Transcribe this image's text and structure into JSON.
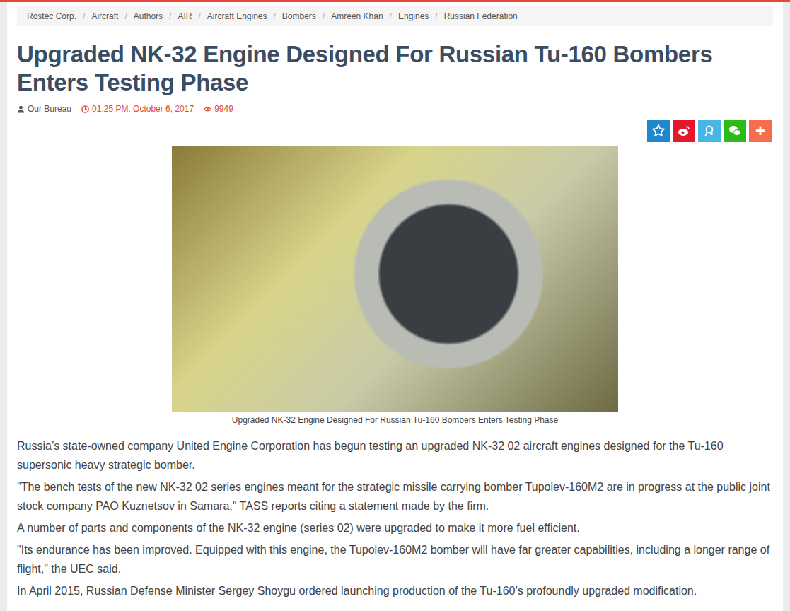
{
  "breadcrumbs": [
    "Rostec Corp.",
    "Aircraft",
    "Authors",
    "AIR",
    "Aircraft Engines",
    "Bombers",
    "Amreen Khan",
    "Engines",
    "Russian Federation"
  ],
  "breadcrumb_separator": "/",
  "title": "Upgraded NK-32 Engine Designed For Russian Tu-160 Bombers Enters Testing Phase",
  "meta": {
    "author": "Our Bureau",
    "time": "01:25 PM, October 6, 2017",
    "views": "9949"
  },
  "share_buttons": [
    {
      "kind": "qzone",
      "color": "#1f86d0"
    },
    {
      "kind": "weibo",
      "color": "#e6162d"
    },
    {
      "kind": "tqq",
      "color": "#45b6e5"
    },
    {
      "kind": "wechat",
      "color": "#2dbb1a"
    },
    {
      "kind": "more",
      "color": "#f56d4c",
      "label": "+"
    }
  ],
  "image": {
    "caption": "Upgraded NK-32 Engine Designed For Russian Tu-160 Bombers Enters Testing Phase"
  },
  "paragraphs": [
    "Russia’s state-owned company United Engine Corporation has begun testing an upgraded NK-32 02 aircraft engines designed for the Tu-160 supersonic heavy strategic bomber.",
    "\"The bench tests of the new NK-32 02 series engines meant for the strategic missile carrying bomber Tupolev-160M2 are in progress at the public joint stock company PAO Kuznetsov in Samara,\" TASS reports citing a statement made by the firm.",
    "A number of parts and components of the NK-32 engine (series 02) were upgraded to make it more fuel efficient.",
    "\"Its endurance has been improved. Equipped with this engine, the Tupolev-160M2 bomber will have far greater capabilities, including a longer range of flight,\" the UEC said.",
    "In April 2015, Russian Defense Minister Sergey Shoygu ordered launching production of the Tu-160’s profoundly upgraded modification."
  ]
}
